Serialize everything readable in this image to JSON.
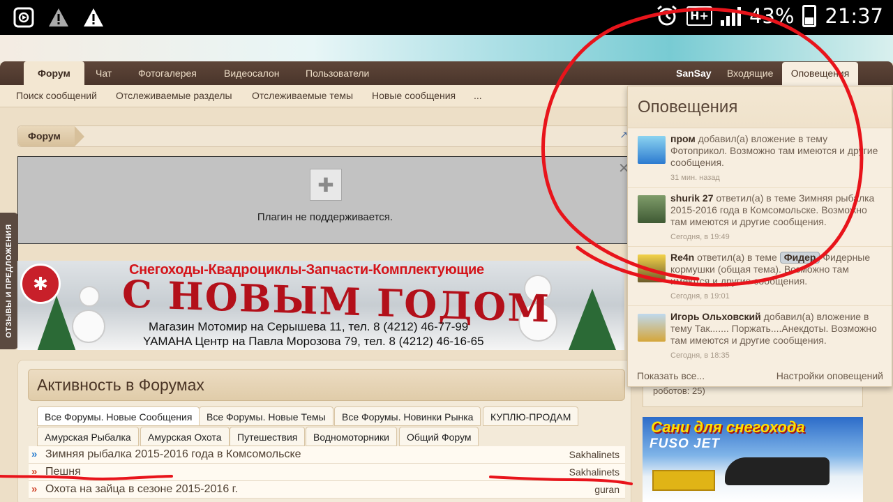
{
  "status_bar": {
    "left_icons": [
      "media-icon",
      "warning-icon",
      "warning-icon"
    ],
    "network": "H+",
    "battery": "43%",
    "time": "21:37"
  },
  "nav": {
    "tabs": [
      "Форум",
      "Чат",
      "Фотогалерея",
      "Видеосалон",
      "Пользователи"
    ],
    "user": "SanSay",
    "inbox": "Входящие",
    "alerts": "Оповещения"
  },
  "subnav": [
    "Поиск сообщений",
    "Отслеживаемые разделы",
    "Отслеживаемые темы",
    "Новые сообщения",
    "..."
  ],
  "breadcrumb": "Форум",
  "plugin": {
    "message": "Плагин не поддерживается."
  },
  "feedback": "ОТЗЫВЫ И ПРЕДЛОЖЕНИЯ",
  "banner": {
    "top": "Снегоходы-Квадроциклы-Запчасти-Комплектующие",
    "big": "С НОВЫМ ГОДОМ",
    "line1": "Магазин Мотомир на Серышева 11, тел. 8 (4212) 46-77-99",
    "line2": "YAMAHA Центр на Павла Морозова 79, тел. 8 (4212) 46-16-65"
  },
  "activity": {
    "title": "Активность в Форумах",
    "tabs_row1": [
      "Все Форумы. Новые Сообщения",
      "Все Форумы. Новые Темы",
      "Все Форумы. Новинки Рынка",
      "КУПЛЮ-ПРОДАМ"
    ],
    "tabs_row2": [
      "Амурская Рыбалка",
      "Амурская Охота",
      "Путешествия",
      "Водномоторники",
      "Общий Форум"
    ],
    "threads": [
      {
        "title": "Зимняя рыбалка 2015-2016 года в Комсомольске",
        "author": "Sakhalinets"
      },
      {
        "title": "Пешня",
        "author": "Sakhalinets"
      },
      {
        "title": "Охота на зайца в сезоне 2015-2016 г.",
        "author": "guran"
      }
    ]
  },
  "sidebar": {
    "partial_text": "роботов: 25)",
    "promo_line1": "Сани для снегохода",
    "promo_line2": "FUSO JET"
  },
  "notifications": {
    "title": "Оповещения",
    "items": [
      {
        "user": "пром",
        "text": "добавил(а) вложение в тему Фотоприкол. Возможно там имеются и другие сообщения.",
        "time": "31 мин. назад"
      },
      {
        "user": "shurik 27",
        "text": "ответил(а) в теме Зимняя рыбалка 2015-2016 года в Комсомольске. Возможно там имеются и другие сообщения.",
        "time": "Сегодня, в 19:49"
      },
      {
        "user": "Re4n",
        "pre": "ответил(а) в теме",
        "chip": "Фидер",
        "text": "Фидерные кормушки (общая тема). Возможно там имеются и другие сообщения.",
        "time": "Сегодня, в 19:01"
      },
      {
        "user": "Игорь Ольховский",
        "text": "добавил(а) вложение в тему Так....... Поржать....Анекдоты. Возможно там имеются и другие сообщения.",
        "time": "Сегодня, в 18:35"
      }
    ],
    "show_all": "Показать все...",
    "settings": "Настройки оповещений"
  },
  "colors": {
    "annotation": "#e8141b",
    "nav_dark": "#4a352b"
  }
}
